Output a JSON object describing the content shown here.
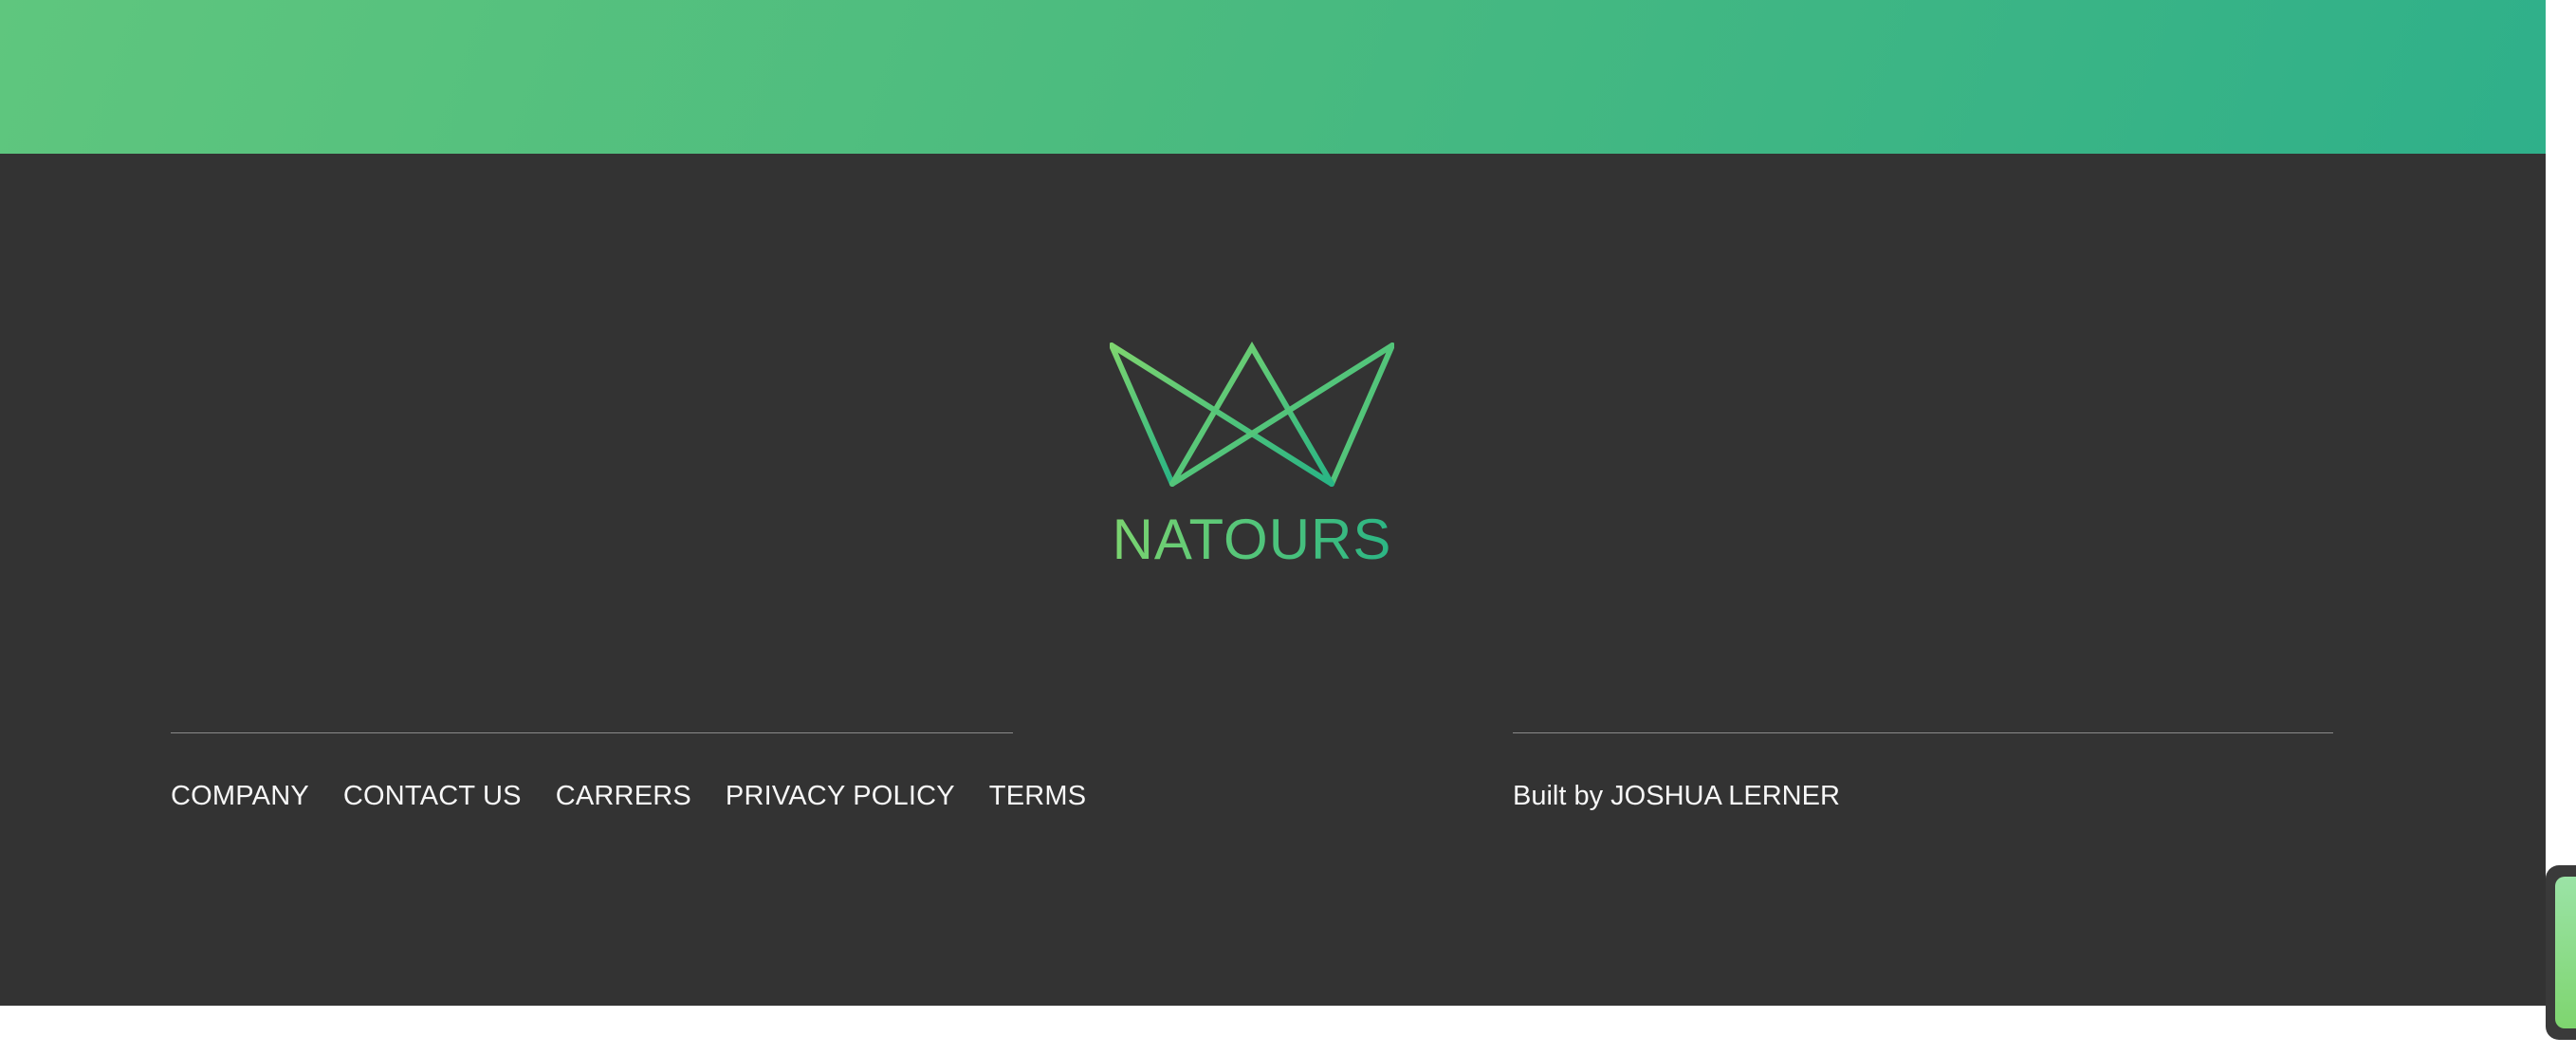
{
  "brand": {
    "name": "NATOURS",
    "logo_icon": "crown-logo-icon",
    "gradient_start": "#7ed56f",
    "gradient_end": "#28b485"
  },
  "colors": {
    "top_band_start": "#5fc67e",
    "top_band_end": "#2fb08a",
    "footer_bg": "#333333",
    "footer_text": "#f7f7f7",
    "divider": "#8a8a8a"
  },
  "footer": {
    "nav": [
      {
        "label": "COMPANY"
      },
      {
        "label": "CONTACT US"
      },
      {
        "label": "CARRERS"
      },
      {
        "label": "PRIVACY POLICY"
      },
      {
        "label": "TERMS"
      }
    ],
    "credit_prefix": "Built by",
    "credit_author": "JOSHUA LERNER"
  },
  "widget": {
    "icon": "chat-widget-icon"
  }
}
